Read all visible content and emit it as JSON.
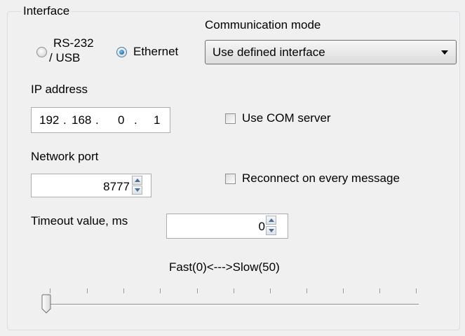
{
  "interface": {
    "title": "Interface",
    "rs232_line1": "RS-232",
    "rs232_line2": "/ USB",
    "ethernet_label": "Ethernet",
    "selected": "Ethernet"
  },
  "communication_mode": {
    "label": "Communication mode",
    "value": "Use defined interface"
  },
  "ip_address": {
    "label": "IP address",
    "octets": [
      "192",
      "168",
      "0",
      "1"
    ]
  },
  "use_com_server": {
    "label": "Use COM server",
    "checked": false
  },
  "network_port": {
    "label": "Network port",
    "value": "8777"
  },
  "reconnect": {
    "label": "Reconnect on every message",
    "checked": false
  },
  "timeout": {
    "label": "Timeout value, ms",
    "value": "0"
  },
  "speed_slider": {
    "label": "Fast(0)<--->Slow(50)",
    "min": 0,
    "max": 50,
    "value": 0
  },
  "colors": {
    "background": "#f0f0f0",
    "groupbox_border": "#d5dfe5",
    "radio_selected": "#1f6fb0"
  },
  "icons": [
    "radio-unchecked-icon",
    "radio-checked-icon",
    "dropdown-arrow-icon",
    "spin-up-icon",
    "spin-down-icon",
    "checkbox-unchecked-icon",
    "slider-thumb-icon"
  ]
}
